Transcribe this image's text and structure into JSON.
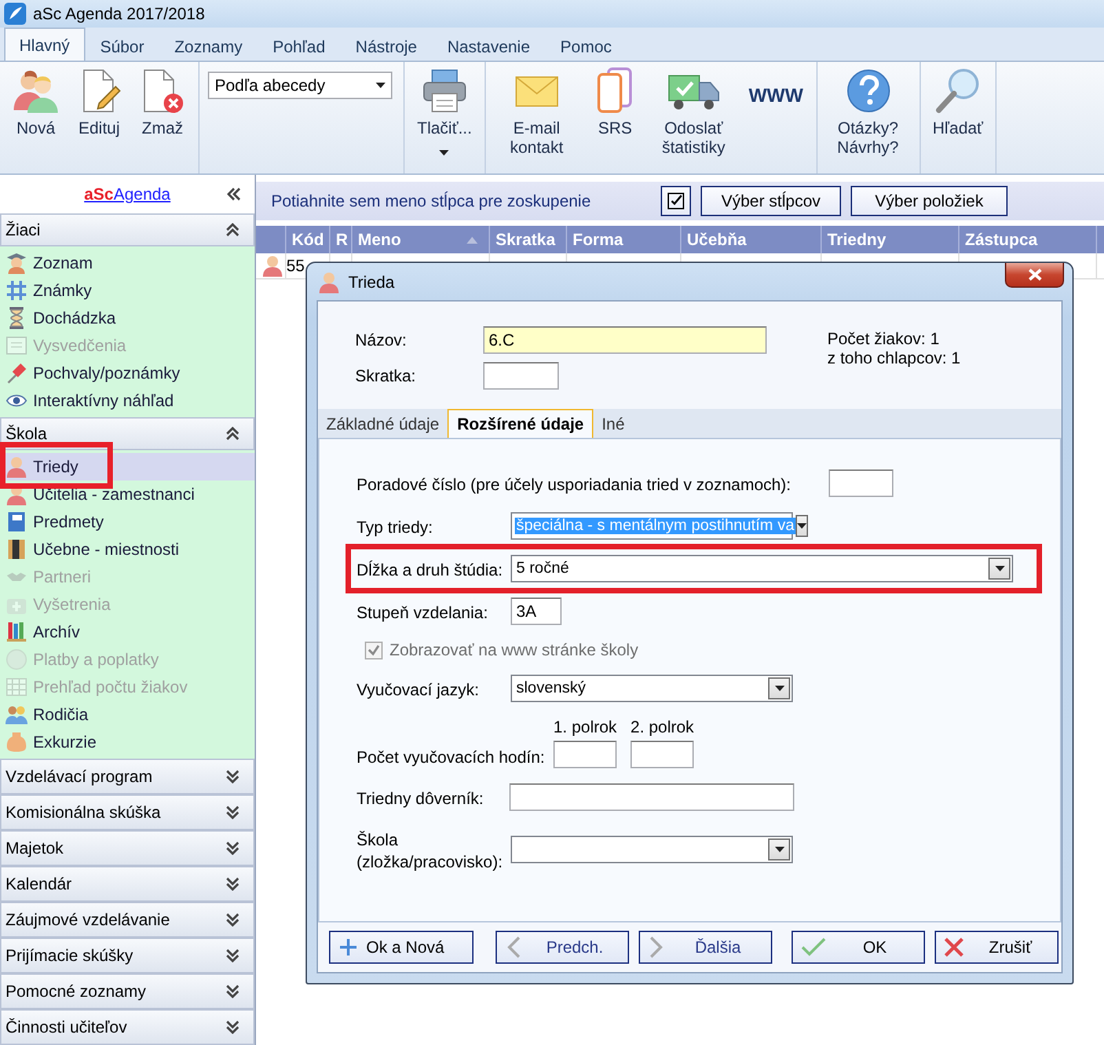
{
  "window": {
    "title": "aSc Agenda 2017/2018"
  },
  "menu_tabs": [
    {
      "label": "Hlavný",
      "selected": true
    },
    {
      "label": "Súbor",
      "selected": false
    },
    {
      "label": "Zoznamy",
      "selected": false
    },
    {
      "label": "Pohľad",
      "selected": false
    },
    {
      "label": "Nástroje",
      "selected": false
    },
    {
      "label": "Nastavenie",
      "selected": false
    },
    {
      "label": "Pomoc",
      "selected": false
    }
  ],
  "ribbon": {
    "groups": [
      {
        "kind": "buttons",
        "buttons": [
          {
            "label": "Nová",
            "kind": "icon"
          },
          {
            "label": "Edituj",
            "kind": "icon"
          },
          {
            "label": "Zmaž",
            "kind": "icon"
          }
        ]
      },
      {
        "kind": "dropdown",
        "value": "Podľa abecedy"
      },
      {
        "kind": "buttons",
        "buttons": [
          {
            "label": "Tlačiť...",
            "kind": "icon",
            "has_menu": true
          }
        ]
      },
      {
        "kind": "buttons",
        "buttons": [
          {
            "label": "E-mail kontakt",
            "kind": "icon"
          },
          {
            "label": "SRS",
            "kind": "icon"
          },
          {
            "label": "Odoslať štatistiky",
            "kind": "icon"
          },
          {
            "label": "WWW",
            "kind": "word"
          }
        ]
      },
      {
        "kind": "buttons",
        "buttons": [
          {
            "label": "Otázky? Návrhy?",
            "kind": "icon"
          }
        ]
      },
      {
        "kind": "buttons",
        "buttons": [
          {
            "label": "Hľadať",
            "kind": "icon"
          }
        ]
      }
    ]
  },
  "sidebar": {
    "logo": {
      "brand": "aSc",
      "name": "Agenda"
    },
    "sections": [
      {
        "title": "Žiaci",
        "expanded": true,
        "items": [
          {
            "label": "Zoznam",
            "disabled": false,
            "selected": false,
            "highlighted": false
          },
          {
            "label": "Známky",
            "disabled": false,
            "selected": false,
            "highlighted": false
          },
          {
            "label": "Dochádzka",
            "disabled": false,
            "selected": false,
            "highlighted": false
          },
          {
            "label": "Vysvedčenia",
            "disabled": true,
            "selected": false,
            "highlighted": false
          },
          {
            "label": "Pochvaly/poznámky",
            "disabled": false,
            "selected": false,
            "highlighted": false
          },
          {
            "label": "Interaktívny náhľad",
            "disabled": false,
            "selected": false,
            "highlighted": false
          }
        ]
      },
      {
        "title": "Škola",
        "expanded": true,
        "items": [
          {
            "label": "Triedy",
            "disabled": false,
            "selected": true,
            "highlighted": true
          },
          {
            "label": "Učitelia - zamestnanci",
            "disabled": false,
            "selected": false,
            "highlighted": false
          },
          {
            "label": "Predmety",
            "disabled": false,
            "selected": false,
            "highlighted": false
          },
          {
            "label": "Učebne - miestnosti",
            "disabled": false,
            "selected": false,
            "highlighted": false
          },
          {
            "label": "Partneri",
            "disabled": true,
            "selected": false,
            "highlighted": false
          },
          {
            "label": "Vyšetrenia",
            "disabled": true,
            "selected": false,
            "highlighted": false
          },
          {
            "label": "Archív",
            "disabled": false,
            "selected": false,
            "highlighted": false
          },
          {
            "label": "Platby a poplatky",
            "disabled": true,
            "selected": false,
            "highlighted": false
          },
          {
            "label": "Prehľad počtu žiakov",
            "disabled": true,
            "selected": false,
            "highlighted": false
          },
          {
            "label": "Rodičia",
            "disabled": false,
            "selected": false,
            "highlighted": false
          },
          {
            "label": "Exkurzie",
            "disabled": false,
            "selected": false,
            "highlighted": false
          }
        ]
      },
      {
        "title": "Vzdelávací program",
        "expanded": false
      },
      {
        "title": "Komisionálna skúška",
        "expanded": false
      },
      {
        "title": "Majetok",
        "expanded": false
      },
      {
        "title": "Kalendár",
        "expanded": false
      },
      {
        "title": "Záujmové vzdelávanie",
        "expanded": false
      },
      {
        "title": "Prijímacie skúšky",
        "expanded": false
      },
      {
        "title": "Pomocné zoznamy",
        "expanded": false
      },
      {
        "title": "Činnosti učiteľov",
        "expanded": false
      }
    ]
  },
  "grid": {
    "group_hint": "Potiahnite sem meno stĺpca pre zoskupenie",
    "buttons": [
      "Výber stĺpcov",
      "Výber položiek"
    ],
    "columns": [
      {
        "label": "Kód",
        "sorted": false
      },
      {
        "label": "R",
        "sorted": false
      },
      {
        "label": "Meno",
        "sorted": true
      },
      {
        "label": "Skratka",
        "sorted": false
      },
      {
        "label": "Forma",
        "sorted": false
      },
      {
        "label": "Učebňa",
        "sorted": false
      },
      {
        "label": "Triedny",
        "sorted": false
      },
      {
        "label": "Zástupca",
        "sorted": false
      }
    ],
    "rows": [
      {
        "cells": [
          "55"
        ]
      }
    ]
  },
  "dialog": {
    "title": "Trieda",
    "name": {
      "label": "Názov:",
      "value": "6.C"
    },
    "abbr": {
      "label": "Skratka:"
    },
    "stats": [
      "Počet žiakov: 1",
      "z toho chlapcov: 1"
    ],
    "tabs": [
      {
        "label": "Základné údaje",
        "selected": false
      },
      {
        "label": "Rozšírené údaje",
        "selected": true
      },
      {
        "label": "Iné",
        "selected": false
      }
    ],
    "fields": [
      {
        "kind": "number",
        "label": "Poradové číslo (pre účely usporiadania tried v zoznamoch):"
      },
      {
        "kind": "select",
        "label": "Typ triedy:",
        "value": "špeciálna - s mentálnym postihnutím va",
        "focused": true
      },
      {
        "kind": "long_select",
        "label": "Dĺžka a druh štúdia:",
        "value": "5 ročné",
        "highlighted": true
      },
      {
        "kind": "short_text",
        "label": "Stupeň vzdelania:",
        "value": "3A"
      },
      {
        "kind": "checkbox",
        "label": "Zobrazovať na www stránke školy",
        "checked": true,
        "disabled": true
      },
      {
        "kind": "select",
        "label": "Vyučovací jazyk:",
        "value": "slovenský"
      },
      {
        "kind": "hours",
        "label": "Počet vyučovacích hodín:",
        "columns": [
          "1. polrok",
          "2. polrok"
        ]
      },
      {
        "kind": "text",
        "label": "Triedny dôverník:"
      },
      {
        "kind": "select",
        "label": "Škola (zložka/pracovisko):"
      }
    ],
    "buttons": [
      {
        "label": "Ok a Nová"
      },
      {
        "label": "Predch."
      },
      {
        "label": "Ďalšia"
      },
      {
        "label": "OK"
      },
      {
        "label": "Zrušiť"
      }
    ]
  }
}
